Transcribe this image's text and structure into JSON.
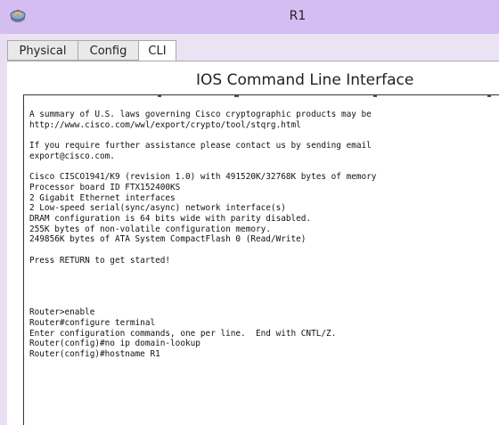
{
  "window": {
    "title": "R1",
    "icon": "router-app-icon"
  },
  "tabs": [
    {
      "label": "Physical",
      "active": false
    },
    {
      "label": "Config",
      "active": false
    },
    {
      "label": "CLI",
      "active": true
    }
  ],
  "cli": {
    "heading": "IOS Command Line Interface",
    "lines": [
      "A summary of U.S. laws governing Cisco cryptographic products may be",
      "http://www.cisco.com/wwl/export/crypto/tool/stqrg.html",
      "",
      "If you require further assistance please contact us by sending email",
      "export@cisco.com.",
      "",
      "Cisco CISCO1941/K9 (revision 1.0) with 491520K/32768K bytes of memory",
      "Processor board ID FTX152400KS",
      "2 Gigabit Ethernet interfaces",
      "2 Low-speed serial(sync/async) network interface(s)",
      "DRAM configuration is 64 bits wide with parity disabled.",
      "255K bytes of non-volatile configuration memory.",
      "249856K bytes of ATA System CompactFlash 0 (Read/Write)",
      "",
      "Press RETURN to get started!",
      "",
      "",
      "",
      "",
      "Router>enable",
      "Router#configure terminal",
      "Enter configuration commands, one per line.  End with CNTL/Z.",
      "Router(config)#no ip domain-lookup",
      "Router(config)#hostname R1"
    ]
  },
  "colors": {
    "titlebar": "#d3bdf1",
    "window_bg": "#ebe3f3",
    "console_bg": "#ffffff"
  }
}
